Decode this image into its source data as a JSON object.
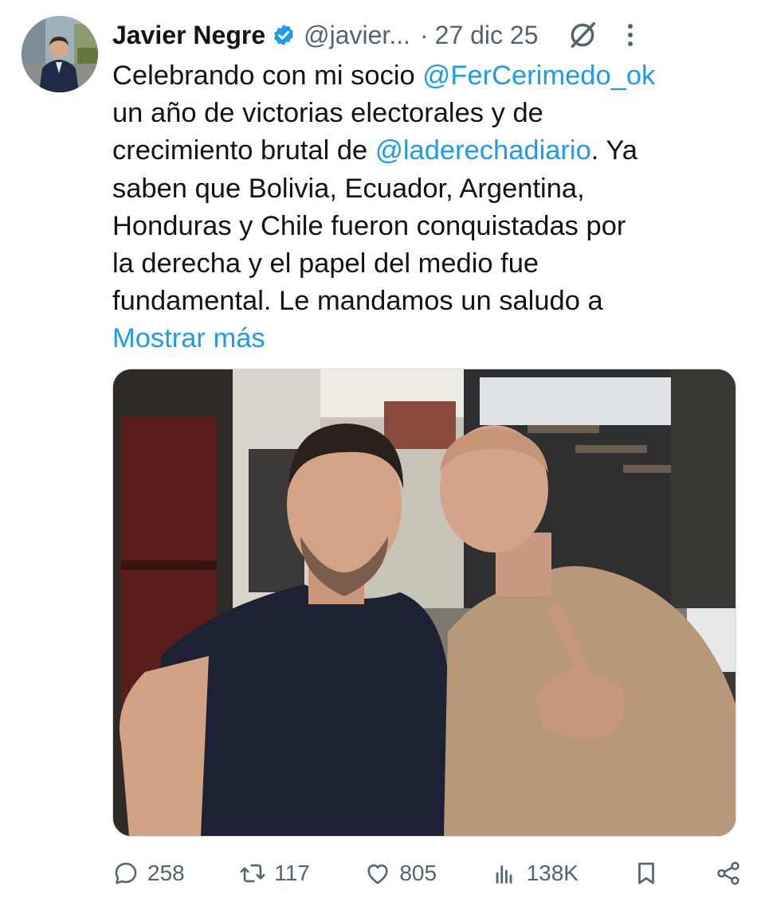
{
  "tweet": {
    "author_name": "Javier Negre",
    "handle": "@javier...",
    "separator": "·",
    "date": "27 dic 25",
    "text": {
      "l1_pre": "Celebrando con mi socio ",
      "l1_mention": "@FerCerimedo_ok",
      "l2": "un año de victorias electorales y de",
      "l3_pre": "crecimiento brutal de ",
      "l3_mention": "@laderechadiario",
      "l3_post": ". Ya",
      "l4": "saben que Bolivia, Ecuador, Argentina,",
      "l5": "Honduras y Chile fueron conquistadas por",
      "l6": "la derecha y el papel del medio fue",
      "l7": "fundamental. Le mandamos un saludo a"
    },
    "show_more": "Mostrar más"
  },
  "actions": {
    "replies": "258",
    "retweets": "117",
    "likes": "805",
    "views": "138K"
  },
  "icons": {
    "verified": "verified-badge-icon",
    "grok": "grok-icon",
    "more": "more-options-icon",
    "reply": "reply-icon",
    "retweet": "retweet-icon",
    "like": "heart-icon",
    "views": "views-icon",
    "bookmark": "bookmark-icon",
    "share": "share-icon"
  },
  "colors": {
    "accent": "#1d9bf0",
    "text": "#0f1419",
    "secondary": "#536471"
  }
}
